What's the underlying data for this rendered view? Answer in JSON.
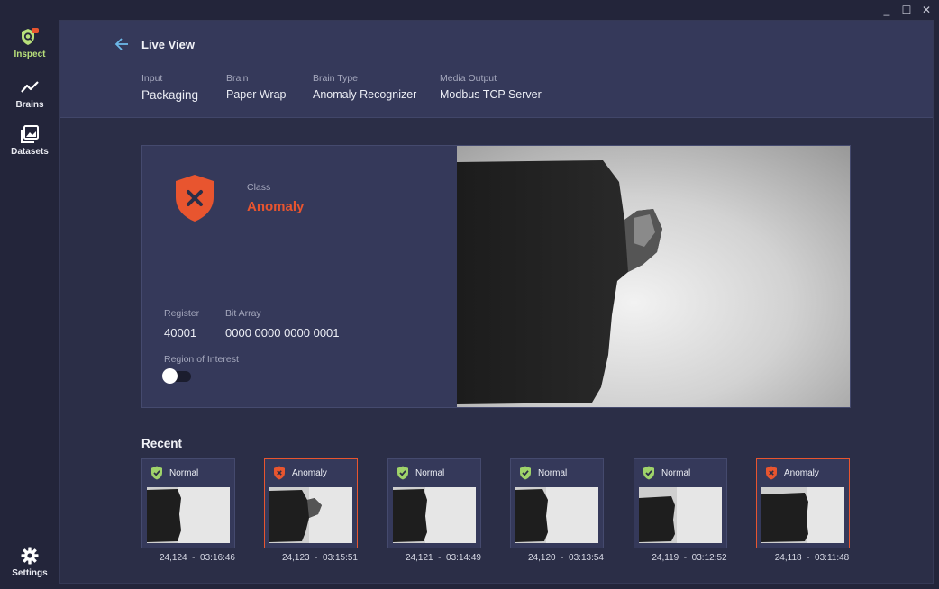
{
  "window_controls": {
    "minimize": "_",
    "maximize": "☐",
    "close": "✕"
  },
  "sidebar": {
    "items": [
      {
        "label": "Inspect",
        "icon": "inspect-shield-icon",
        "active": true
      },
      {
        "label": "Brains",
        "icon": "trend-line-icon"
      },
      {
        "label": "Datasets",
        "icon": "image-stack-icon"
      },
      {
        "label": "Settings",
        "icon": "gear-icon"
      }
    ]
  },
  "header": {
    "title": "Live View",
    "meta": [
      {
        "label": "Input",
        "value": "Packaging"
      },
      {
        "label": "Brain",
        "value": "Paper Wrap"
      },
      {
        "label": "Brain Type",
        "value": "Anomaly Recognizer"
      },
      {
        "label": "Media Output",
        "value": "Modbus TCP Server"
      }
    ]
  },
  "result": {
    "class_label": "Class",
    "class_value": "Anomaly",
    "register_label": "Register",
    "register_value": "40001",
    "bits_label": "Bit Array",
    "bits_value": "0000 0000 0000 0001",
    "roi_label": "Region of Interest",
    "roi_enabled": false
  },
  "recent": {
    "title": "Recent",
    "items": [
      {
        "status": "Normal",
        "id": "24,124",
        "time": "03:16:46"
      },
      {
        "status": "Anomaly",
        "id": "24,123",
        "time": "03:15:51"
      },
      {
        "status": "Normal",
        "id": "24,121",
        "time": "03:14:49"
      },
      {
        "status": "Normal",
        "id": "24,120",
        "time": "03:13:54"
      },
      {
        "status": "Normal",
        "id": "24,119",
        "time": "03:12:52"
      },
      {
        "status": "Anomaly",
        "id": "24,118",
        "time": "03:11:48"
      }
    ]
  },
  "colors": {
    "accent_green": "#b8e07a",
    "anomaly_orange": "#e8552f",
    "normal_green": "#9fd36a"
  }
}
